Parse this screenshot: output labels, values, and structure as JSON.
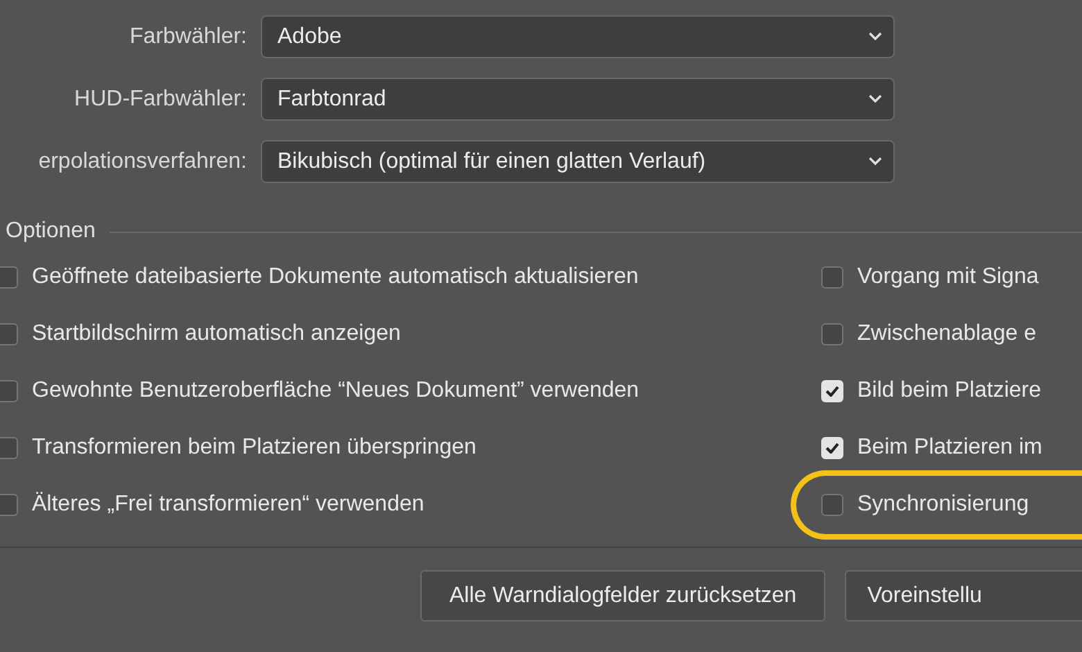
{
  "fields": [
    {
      "label": "Farbwähler:",
      "value": "Adobe"
    },
    {
      "label": "HUD-Farbwähler:",
      "value": "Farbtonrad"
    },
    {
      "label": "erpolationsverfahren:",
      "value": "Bikubisch (optimal für einen glatten Verlauf)"
    }
  ],
  "options": {
    "title": "Optionen",
    "left": [
      {
        "label": "Geöffnete dateibasierte Dokumente automatisch aktualisieren",
        "checked": false,
        "highlighted": false
      },
      {
        "label": "Startbildschirm automatisch anzeigen",
        "checked": false,
        "highlighted": false
      },
      {
        "label": "Gewohnte Benutzeroberfläche “Neues Dokument” verwenden",
        "checked": false,
        "highlighted": false
      },
      {
        "label": "Transformieren beim Platzieren überspringen",
        "checked": false,
        "highlighted": false
      },
      {
        "label": "Älteres „Frei transformieren“ verwenden",
        "checked": false,
        "highlighted": false
      }
    ],
    "right": [
      {
        "label": "Vorgang mit Signa",
        "checked": false,
        "highlighted": false
      },
      {
        "label": "Zwischenablage e",
        "checked": false,
        "highlighted": false
      },
      {
        "label": "Bild beim Platziere",
        "checked": true,
        "highlighted": false
      },
      {
        "label": "Beim Platzieren im",
        "checked": true,
        "highlighted": false
      },
      {
        "label": "Synchronisierung",
        "checked": false,
        "highlighted": true
      }
    ]
  },
  "buttons": [
    "Alle Warndialogfelder zurücksetzen",
    "Voreinstellu"
  ]
}
